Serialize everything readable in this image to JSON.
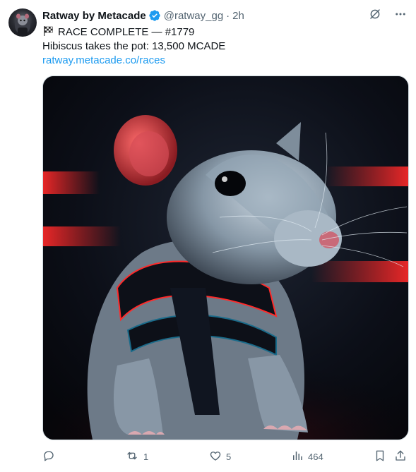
{
  "author": {
    "name": "Ratway by Metacade",
    "handle": "@ratway_gg",
    "time": "2h",
    "dot": "·",
    "verified_color": "#1d9bf0"
  },
  "tweet": {
    "line1": "RACE COMPLETE — #1779",
    "line2": "Hibiscus takes the pot: 13,500 MCADE",
    "link": "ratway.metacade.co/races",
    "flag_icon": "checkered-flag-icon"
  },
  "media": {
    "description_icon": "rat-image"
  },
  "actions": {
    "replies": "",
    "retweets": "1",
    "likes": "5",
    "views": "464"
  },
  "colors": {
    "text": "#0f1419",
    "secondary": "#536471",
    "link": "#1d9bf0"
  }
}
